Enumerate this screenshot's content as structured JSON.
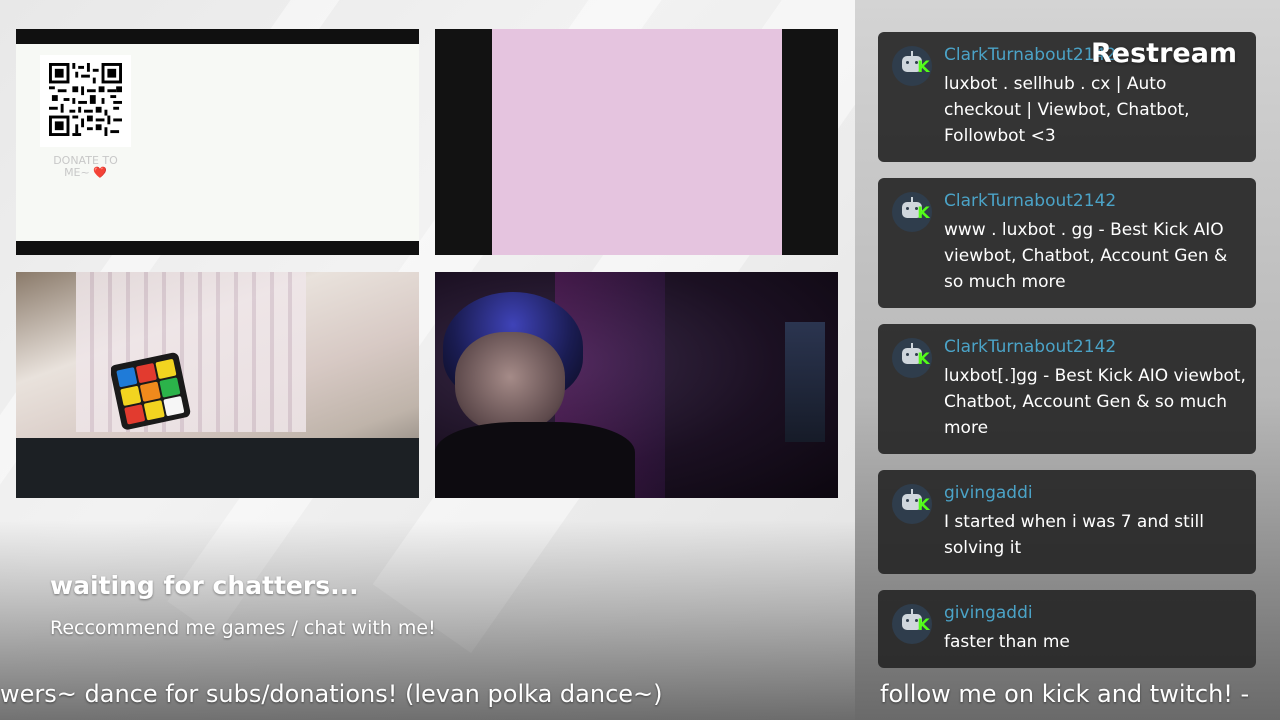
{
  "stream": {
    "status_title": "waiting for chatters...",
    "status_subtitle": "Reccommend me games / chat with me!",
    "ticker_left": "wers~ dance for subs/donations! (levan polka dance~)",
    "ticker_right": "follow me on kick and twitch! -"
  },
  "donate": {
    "label": "DONATE TO ME~ ❤️"
  },
  "brand": {
    "name": "Restream"
  },
  "chat": {
    "messages": [
      {
        "username": "ClarkTurnabout2142",
        "text": "luxbot . sellhub . cx | Auto checkout | Viewbot, Chatbot, Followbot <3",
        "platform_icon": "kick-icon"
      },
      {
        "username": "ClarkTurnabout2142",
        "text": "www . luxbot . gg - Best Kick AIO viewbot, Chatbot, Account Gen & so much more",
        "platform_icon": "kick-icon"
      },
      {
        "username": "ClarkTurnabout2142",
        "text": "luxbot[.]gg - Best Kick AIO viewbot, Chatbot, Account Gen & so much more",
        "platform_icon": "kick-icon"
      },
      {
        "username": "givingaddi",
        "text": "I started when i was 7 and still solving it",
        "platform_icon": "kick-icon"
      },
      {
        "username": "givingaddi",
        "text": "faster than me",
        "platform_icon": "kick-icon"
      }
    ]
  },
  "colors": {
    "kick_green": "#53fc18",
    "username_blue": "#4ba3c7",
    "chat_bubble": "#282828",
    "pink_tile": "#e5c4df"
  }
}
